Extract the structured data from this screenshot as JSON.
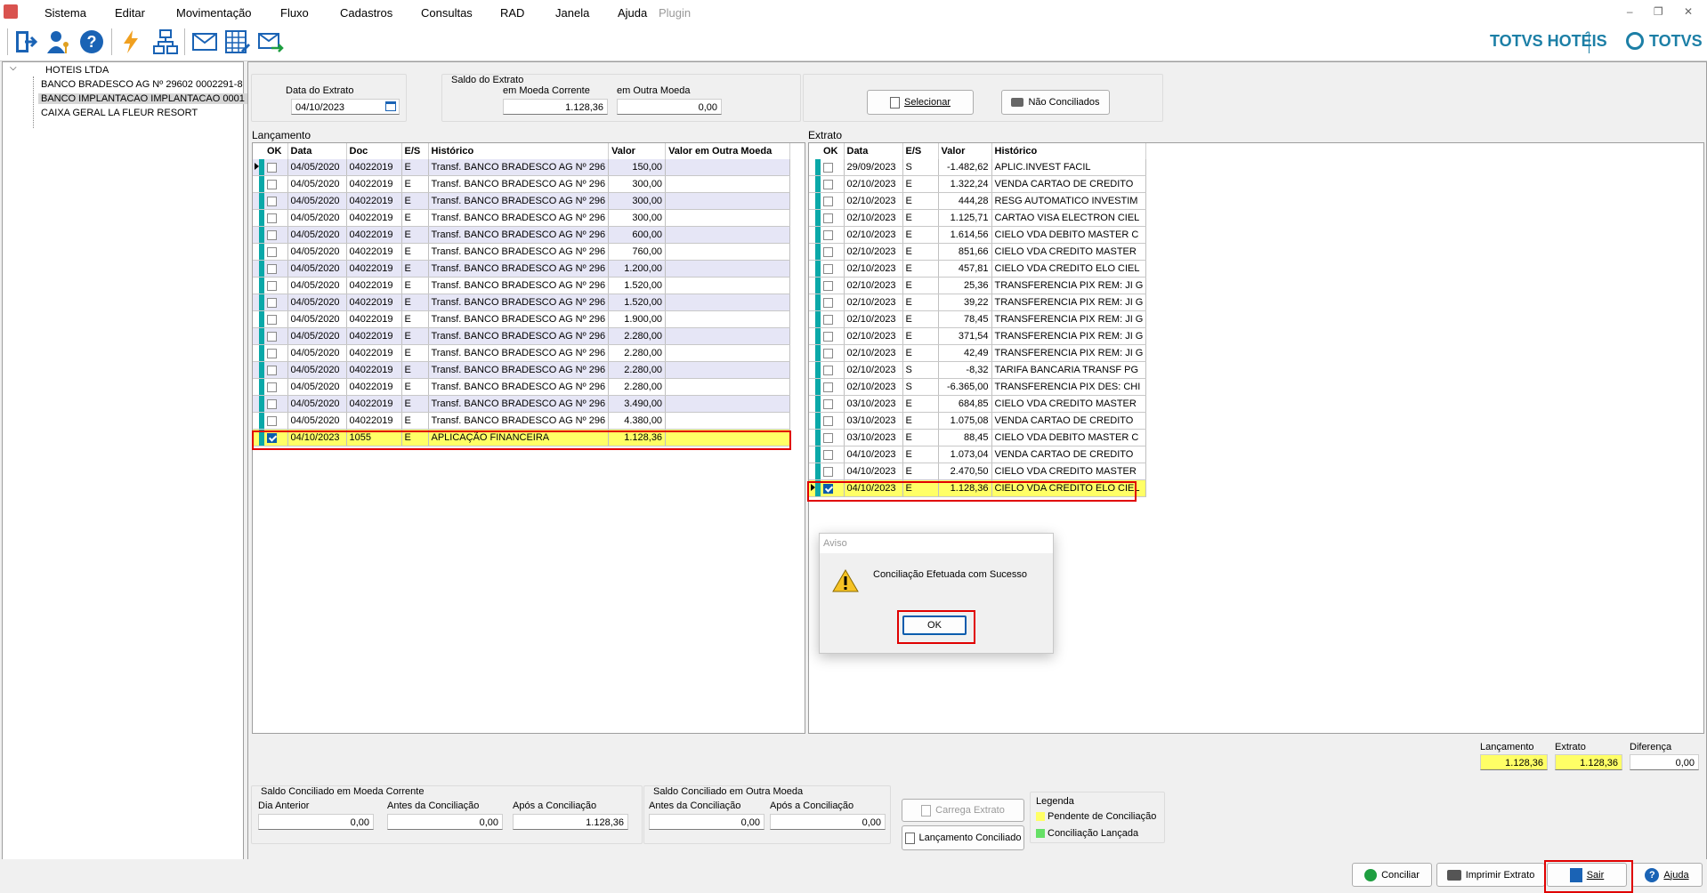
{
  "menu": {
    "items": [
      "Sistema",
      "Editar",
      "Movimentação",
      "Fluxo",
      "Cadastros",
      "Consultas",
      "RAD",
      "Janela",
      "Ajuda"
    ],
    "plugin_label": "Plugin",
    "window_controls": "– ❐ ✕"
  },
  "toolbar": {
    "icons": [
      "exit-icon",
      "user-key-icon",
      "help-icon",
      "lightning-icon",
      "network-icon",
      "mail-icon",
      "spreadsheet-icon",
      "mail-send-icon"
    ]
  },
  "brand": {
    "hotel": "TOTVS HOTÉIS",
    "totvs": "TOTVS"
  },
  "tree": {
    "root": "HOTEIS LTDA",
    "items": [
      "BANCO BRADESCO AG Nº 29602 0002291-8",
      "BANCO IMPLANTACAO IMPLANTACAO 0001",
      "CAIXA GERAL LA FLEUR RESORT"
    ],
    "selected_index": 1
  },
  "header": {
    "data_extrato_label": "Data do Extrato",
    "data_extrato_value": "04/10/2023",
    "saldo_label": "Saldo do Extrato",
    "moeda_corrente_label": "em Moeda Corrente",
    "moeda_corrente_value": "1.128,36",
    "outra_moeda_label": "em Outra Moeda",
    "outra_moeda_value": "0,00",
    "selecionar_label": "Selecionar",
    "nao_conciliados_label": "Não Conciliados"
  },
  "lancamento": {
    "title": "Lançamento",
    "columns": [
      "OK",
      "Data",
      "Doc",
      "E/S",
      "Histórico",
      "Valor",
      "Valor em Outra Moeda"
    ],
    "rows": [
      {
        "ok": false,
        "data": "04/05/2020",
        "doc": "04022019",
        "es": "E",
        "historico": "Transf. BANCO BRADESCO AG Nº 296",
        "valor": "150,00",
        "outra": ""
      },
      {
        "ok": false,
        "data": "04/05/2020",
        "doc": "04022019",
        "es": "E",
        "historico": "Transf. BANCO BRADESCO AG Nº 296",
        "valor": "300,00",
        "outra": ""
      },
      {
        "ok": false,
        "data": "04/05/2020",
        "doc": "04022019",
        "es": "E",
        "historico": "Transf. BANCO BRADESCO AG Nº 296",
        "valor": "300,00",
        "outra": ""
      },
      {
        "ok": false,
        "data": "04/05/2020",
        "doc": "04022019",
        "es": "E",
        "historico": "Transf. BANCO BRADESCO AG Nº 296",
        "valor": "300,00",
        "outra": ""
      },
      {
        "ok": false,
        "data": "04/05/2020",
        "doc": "04022019",
        "es": "E",
        "historico": "Transf. BANCO BRADESCO AG Nº 296",
        "valor": "600,00",
        "outra": ""
      },
      {
        "ok": false,
        "data": "04/05/2020",
        "doc": "04022019",
        "es": "E",
        "historico": "Transf. BANCO BRADESCO AG Nº 296",
        "valor": "760,00",
        "outra": ""
      },
      {
        "ok": false,
        "data": "04/05/2020",
        "doc": "04022019",
        "es": "E",
        "historico": "Transf. BANCO BRADESCO AG Nº 296",
        "valor": "1.200,00",
        "outra": ""
      },
      {
        "ok": false,
        "data": "04/05/2020",
        "doc": "04022019",
        "es": "E",
        "historico": "Transf. BANCO BRADESCO AG Nº 296",
        "valor": "1.520,00",
        "outra": ""
      },
      {
        "ok": false,
        "data": "04/05/2020",
        "doc": "04022019",
        "es": "E",
        "historico": "Transf. BANCO BRADESCO AG Nº 296",
        "valor": "1.520,00",
        "outra": ""
      },
      {
        "ok": false,
        "data": "04/05/2020",
        "doc": "04022019",
        "es": "E",
        "historico": "Transf. BANCO BRADESCO AG Nº 296",
        "valor": "1.900,00",
        "outra": ""
      },
      {
        "ok": false,
        "data": "04/05/2020",
        "doc": "04022019",
        "es": "E",
        "historico": "Transf. BANCO BRADESCO AG Nº 296",
        "valor": "2.280,00",
        "outra": ""
      },
      {
        "ok": false,
        "data": "04/05/2020",
        "doc": "04022019",
        "es": "E",
        "historico": "Transf. BANCO BRADESCO AG Nº 296",
        "valor": "2.280,00",
        "outra": ""
      },
      {
        "ok": false,
        "data": "04/05/2020",
        "doc": "04022019",
        "es": "E",
        "historico": "Transf. BANCO BRADESCO AG Nº 296",
        "valor": "2.280,00",
        "outra": ""
      },
      {
        "ok": false,
        "data": "04/05/2020",
        "doc": "04022019",
        "es": "E",
        "historico": "Transf. BANCO BRADESCO AG Nº 296",
        "valor": "2.280,00",
        "outra": ""
      },
      {
        "ok": false,
        "data": "04/05/2020",
        "doc": "04022019",
        "es": "E",
        "historico": "Transf. BANCO BRADESCO AG Nº 296",
        "valor": "3.490,00",
        "outra": ""
      },
      {
        "ok": false,
        "data": "04/05/2020",
        "doc": "04022019",
        "es": "E",
        "historico": "Transf. BANCO BRADESCO AG Nº 296",
        "valor": "4.380,00",
        "outra": ""
      },
      {
        "ok": true,
        "data": "04/10/2023",
        "doc": "1055",
        "es": "E",
        "historico": "APLICAÇÃO FINANCEIRA",
        "valor": "1.128,36",
        "outra": "",
        "highlight": true
      }
    ]
  },
  "extrato": {
    "title": "Extrato",
    "columns": [
      "OK",
      "Data",
      "E/S",
      "Valor",
      "Histórico"
    ],
    "rows": [
      {
        "ok": false,
        "data": "29/09/2023",
        "es": "S",
        "valor": "-1.482,62",
        "historico": "APLIC.INVEST FACIL"
      },
      {
        "ok": false,
        "data": "02/10/2023",
        "es": "E",
        "valor": "1.322,24",
        "historico": "VENDA CARTAO DE CREDITO"
      },
      {
        "ok": false,
        "data": "02/10/2023",
        "es": "E",
        "valor": "444,28",
        "historico": "RESG AUTOMATICO INVESTIM"
      },
      {
        "ok": false,
        "data": "02/10/2023",
        "es": "E",
        "valor": "1.125,71",
        "historico": "CARTAO VISA ELECTRON CIEL"
      },
      {
        "ok": false,
        "data": "02/10/2023",
        "es": "E",
        "valor": "1.614,56",
        "historico": "CIELO VDA DEBITO MASTER C"
      },
      {
        "ok": false,
        "data": "02/10/2023",
        "es": "E",
        "valor": "851,66",
        "historico": "CIELO VDA CREDITO MASTER"
      },
      {
        "ok": false,
        "data": "02/10/2023",
        "es": "E",
        "valor": "457,81",
        "historico": "CIELO VDA CREDITO ELO CIEL"
      },
      {
        "ok": false,
        "data": "02/10/2023",
        "es": "E",
        "valor": "25,36",
        "historico": "TRANSFERENCIA PIX REM: JI G"
      },
      {
        "ok": false,
        "data": "02/10/2023",
        "es": "E",
        "valor": "39,22",
        "historico": "TRANSFERENCIA PIX REM: JI G"
      },
      {
        "ok": false,
        "data": "02/10/2023",
        "es": "E",
        "valor": "78,45",
        "historico": "TRANSFERENCIA PIX REM: JI G"
      },
      {
        "ok": false,
        "data": "02/10/2023",
        "es": "E",
        "valor": "371,54",
        "historico": "TRANSFERENCIA PIX REM: JI G"
      },
      {
        "ok": false,
        "data": "02/10/2023",
        "es": "E",
        "valor": "42,49",
        "historico": "TRANSFERENCIA PIX REM: JI G"
      },
      {
        "ok": false,
        "data": "02/10/2023",
        "es": "S",
        "valor": "-8,32",
        "historico": "TARIFA BANCARIA TRANSF PG"
      },
      {
        "ok": false,
        "data": "02/10/2023",
        "es": "S",
        "valor": "-6.365,00",
        "historico": "TRANSFERENCIA PIX DES: CHI"
      },
      {
        "ok": false,
        "data": "03/10/2023",
        "es": "E",
        "valor": "684,85",
        "historico": "CIELO VDA CREDITO MASTER"
      },
      {
        "ok": false,
        "data": "03/10/2023",
        "es": "E",
        "valor": "1.075,08",
        "historico": "VENDA CARTAO DE CREDITO"
      },
      {
        "ok": false,
        "data": "03/10/2023",
        "es": "E",
        "valor": "88,45",
        "historico": "CIELO VDA DEBITO MASTER C"
      },
      {
        "ok": false,
        "data": "04/10/2023",
        "es": "E",
        "valor": "1.073,04",
        "historico": "VENDA CARTAO DE CREDITO"
      },
      {
        "ok": false,
        "data": "04/10/2023",
        "es": "E",
        "valor": "2.470,50",
        "historico": "CIELO VDA CREDITO MASTER"
      },
      {
        "ok": true,
        "data": "04/10/2023",
        "es": "E",
        "valor": "1.128,36",
        "historico": "CIELO VDA CREDITO ELO CIEL",
        "highlight": true
      }
    ]
  },
  "totals": {
    "lancamento_label": "Lançamento",
    "lancamento_value": "1.128,36",
    "extrato_label": "Extrato",
    "extrato_value": "1.128,36",
    "diferenca_label": "Diferença",
    "diferenca_value": "0,00"
  },
  "saldo_corrente": {
    "title": "Saldo Conciliado em Moeda Corrente",
    "dia_anterior_label": "Dia Anterior",
    "dia_anterior_value": "0,00",
    "antes_label": "Antes da Conciliação",
    "antes_value": "0,00",
    "apos_label": "Após a Conciliação",
    "apos_value": "1.128,36"
  },
  "saldo_outra": {
    "title": "Saldo Conciliado em Outra Moeda",
    "antes_label": "Antes da Conciliação",
    "antes_value": "0,00",
    "apos_label": "Após a Conciliação",
    "apos_value": "0,00"
  },
  "actions": {
    "carrega_extrato_label": "Carrega Extrato",
    "lancamento_conciliado_label": "Lançamento Conciliado"
  },
  "legenda": {
    "title": "Legenda",
    "pendente_label": "Pendente de Conciliação",
    "pendente_color": "#ffff66",
    "lancada_label": "Conciliação Lançada",
    "lancada_color": "#66e066"
  },
  "bottom": {
    "conciliar_label": "Conciliar",
    "imprimir_label": "Imprimir Extrato",
    "sair_label": "Sair",
    "ajuda_label": "Ajuda"
  },
  "dialog": {
    "title": "Aviso",
    "message": "Conciliação Efetuada com Sucesso",
    "ok_label": "OK"
  },
  "colors": {
    "row_marker": "#0aa8a8",
    "highlight_yellow": "#ffff66",
    "alt_row": "#e6e6f6",
    "brand_blue": "#1c7fa6",
    "annotation_red": "#e00000"
  }
}
